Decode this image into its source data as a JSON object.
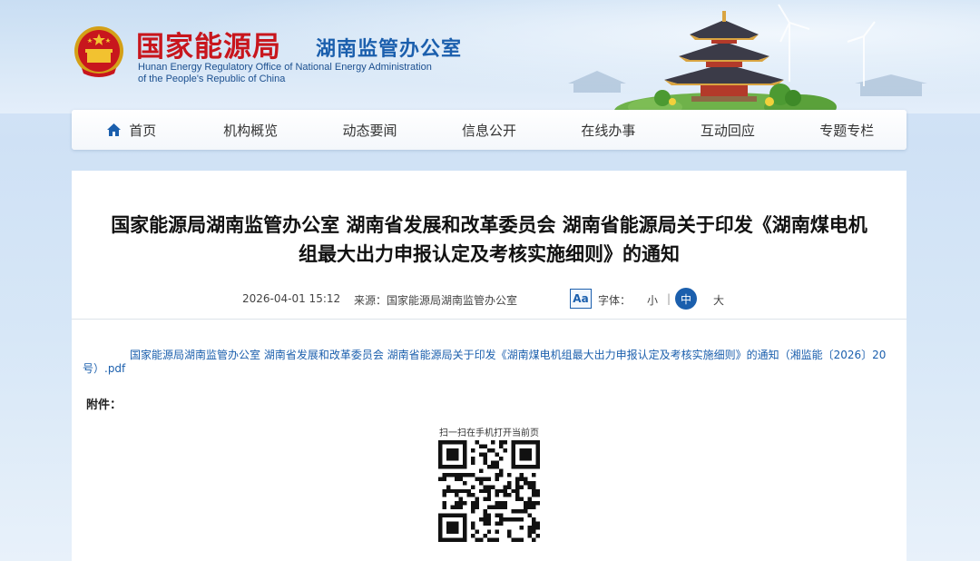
{
  "header": {
    "title_cn": "国家能源局",
    "title_sub": "湖南监管办公室",
    "title_en_line1": "Hunan Energy Regulatory Office of National Energy Administration",
    "title_en_line2": "of the People's Republic of China"
  },
  "nav": {
    "items": [
      {
        "label": "首页",
        "icon": "home-icon"
      },
      {
        "label": "机构概览"
      },
      {
        "label": "动态要闻"
      },
      {
        "label": "信息公开"
      },
      {
        "label": "在线办事"
      },
      {
        "label": "互动回应"
      },
      {
        "label": "专题专栏"
      }
    ]
  },
  "article": {
    "title_line1": "国家能源局湖南监管办公室 湖南省发展和改革委员会 湖南省能源局关于印发《湖南煤电机",
    "title_line2": "组最大出力申报认定及考核实施细则》的通知",
    "date": "2026-04-01 15:12",
    "source_label": "来源：",
    "source": "国家能源局湖南监管办公室",
    "font_toggle": "Aa",
    "font_label": "字体：",
    "font_small": "小",
    "font_separator": "|",
    "font_medium": "中",
    "font_large": "大",
    "pdf_link": "国家能源局湖南监管办公室 湖南省发展和改革委员会 湖南省能源局关于印发《湖南煤电机组最大出力申报认定及考核实施细则》的通知（湘监能〔2026〕20号）.pdf",
    "attachment_label": "附件：",
    "qr_caption": "扫一扫在手机打开当前页"
  },
  "colors": {
    "brand_red": "#c8161d",
    "brand_blue": "#1b5fad"
  }
}
